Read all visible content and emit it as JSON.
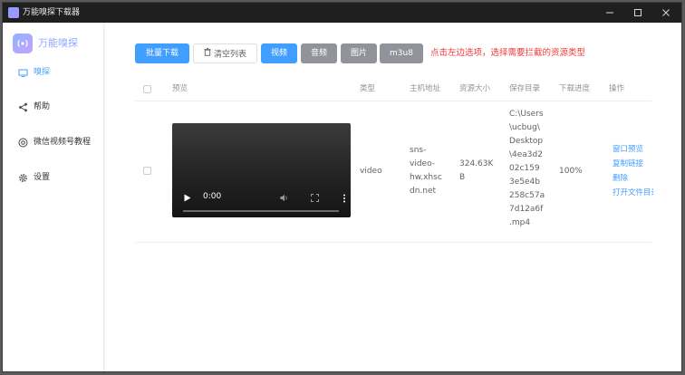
{
  "window": {
    "title": "万能嗅探下载器"
  },
  "sidebar": {
    "logo_text": "万能嗅探",
    "items": [
      {
        "label": "嗅探",
        "icon": "monitor-icon",
        "active": true
      },
      {
        "label": "帮助",
        "icon": "share-icon",
        "active": false
      },
      {
        "label": "微信视频号教程",
        "icon": "wechat-channels-icon",
        "active": false
      },
      {
        "label": "设置",
        "icon": "gear-icon",
        "active": false
      }
    ]
  },
  "toolbar": {
    "batch_download": "批量下载",
    "clear_list": "清空列表",
    "filters": [
      "视频",
      "音频",
      "图片",
      "m3u8"
    ],
    "hint": "点击左边选项，选择需要拦截的资源类型"
  },
  "table": {
    "headers": [
      "预览",
      "类型",
      "主机地址",
      "资源大小",
      "保存目录",
      "下载进度",
      "操作"
    ],
    "rows": [
      {
        "preview_time": "0:00",
        "type": "video",
        "host_lines": [
          "sns-",
          "video-",
          "hw.xhsc",
          "dn.net"
        ],
        "size_lines": [
          "324.63K",
          "B"
        ],
        "path_lines": [
          "C:\\Users",
          "\\ucbug\\",
          "Desktop",
          "\\4ea3d2",
          "02c159",
          "3e5e4b",
          "258c57a",
          "7d12a6f",
          ".mp4"
        ],
        "progress": "100%",
        "actions": [
          "窗口预览",
          "复制链接",
          "删除",
          "打开文件目录"
        ]
      }
    ]
  },
  "colors": {
    "accent": "#409eff",
    "hint_red": "#f23a3a",
    "filter_gray": "#909399",
    "titlebar": "#1f1f1f"
  }
}
